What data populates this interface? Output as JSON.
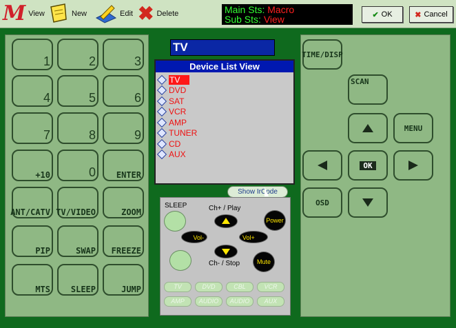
{
  "toolbar": {
    "view_label": "View",
    "new_label": "New",
    "edit_label": "Edit",
    "delete_label": "Delete",
    "status_main_label": "Main Sts:",
    "status_main_value": "Macro",
    "status_sub_label": "Sub Sts:",
    "status_sub_value": "View",
    "ok_label": "OK",
    "cancel_label": "Cancel"
  },
  "keypad": [
    {
      "label": "1"
    },
    {
      "label": "2"
    },
    {
      "label": "3"
    },
    {
      "label": "4"
    },
    {
      "label": "5"
    },
    {
      "label": "6"
    },
    {
      "label": "7"
    },
    {
      "label": "8"
    },
    {
      "label": "9"
    },
    {
      "label": "+10"
    },
    {
      "label": "0"
    },
    {
      "label": "ENTER"
    },
    {
      "label": "ANT/CATV"
    },
    {
      "label": "TV/VIDEO"
    },
    {
      "label": "ZOOM"
    },
    {
      "label": "PIP"
    },
    {
      "label": "SWAP"
    },
    {
      "label": "FREEZE"
    },
    {
      "label": "MTS"
    },
    {
      "label": "SLEEP"
    },
    {
      "label": "JUMP"
    }
  ],
  "device_title": "TV",
  "device_list": {
    "header": "Device List View",
    "items": [
      "TV",
      "DVD",
      "SAT",
      "VCR",
      "AMP",
      "TUNER",
      "CD",
      "AUX"
    ],
    "selected": "TV"
  },
  "show_ircode_label": "Show IrCode",
  "remote": {
    "sleep": "SLEEP",
    "ch_up": "Ch+ / Play",
    "ch_down": "Ch- / Stop",
    "power": "Power",
    "vol_down": "Vol-",
    "vol_up": "Vol+",
    "mute": "Mute",
    "devices": [
      "TV",
      "DVD",
      "CBL",
      "VCR",
      "AMP",
      "AUDIO",
      "AUDIO",
      "AUX"
    ]
  },
  "nav": {
    "time_disp": "TIME/DISP",
    "scan": "SCAN",
    "menu": "MENU",
    "ok": "OK",
    "osd": "OSD"
  }
}
